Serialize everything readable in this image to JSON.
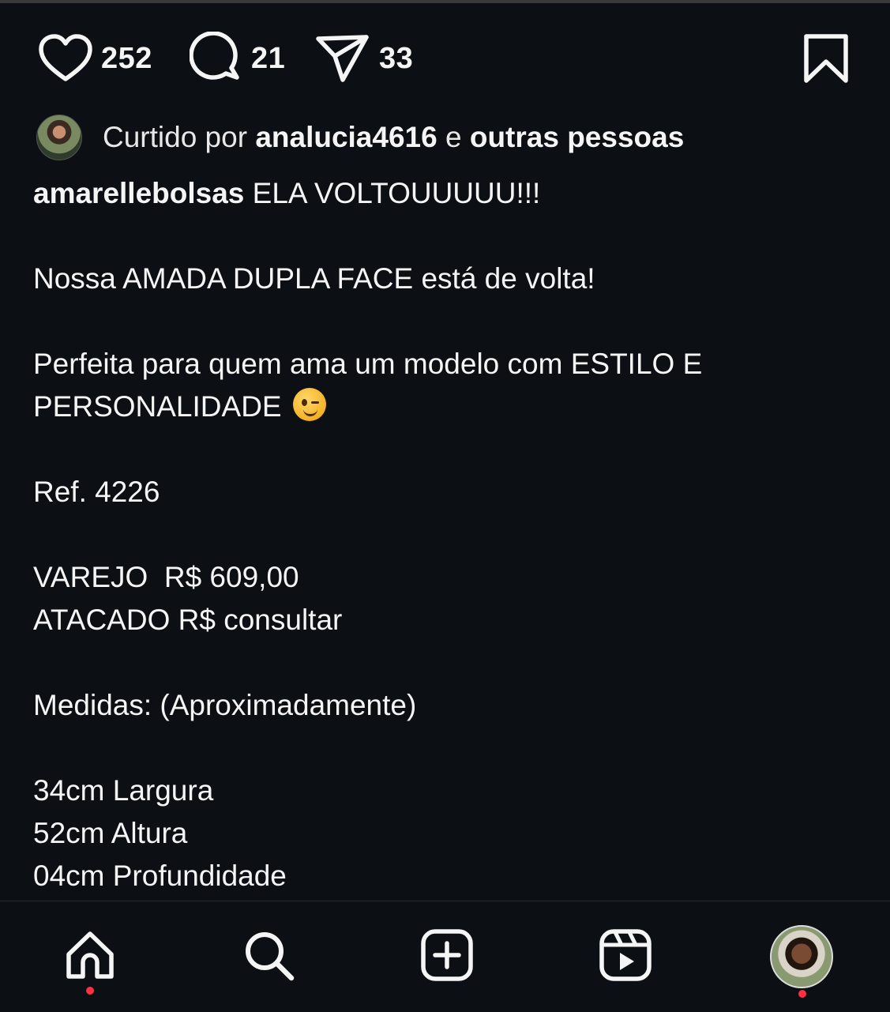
{
  "actions": {
    "likes": "252",
    "comments": "21",
    "shares": "33"
  },
  "liked_by": {
    "prefix": "Curtido por",
    "user": "analucia4616",
    "joiner": "e",
    "others": "outras pessoas"
  },
  "caption": {
    "username": "amarellebolsas",
    "line1": "ELA VOLTOUUUUU!!!",
    "line2": "Nossa AMADA DUPLA FACE está de volta!",
    "line3a": "Perfeita para quem ama um modelo com ESTILO E",
    "line3b": "PERSONALIDADE",
    "ref": "Ref. 4226",
    "varejo": "VAREJO  R$ 609,00",
    "atacado": "ATACADO R$ consultar",
    "medidas": "Medidas: (Aproximadamente)",
    "largura": "34cm Largura",
    "altura": "52cm Altura",
    "profundidade": "04cm Profundidade"
  },
  "icons": {
    "like": "heart-icon",
    "comment": "comment-icon",
    "share": "share-icon",
    "save": "bookmark-icon",
    "emoji": "wink-emoji-icon",
    "nav": [
      "home-icon",
      "search-icon",
      "create-icon",
      "reels-icon",
      "profile-avatar"
    ]
  },
  "colors": {
    "background": "#0c1014",
    "text": "#f5f5f5",
    "notification": "#ff3040"
  }
}
